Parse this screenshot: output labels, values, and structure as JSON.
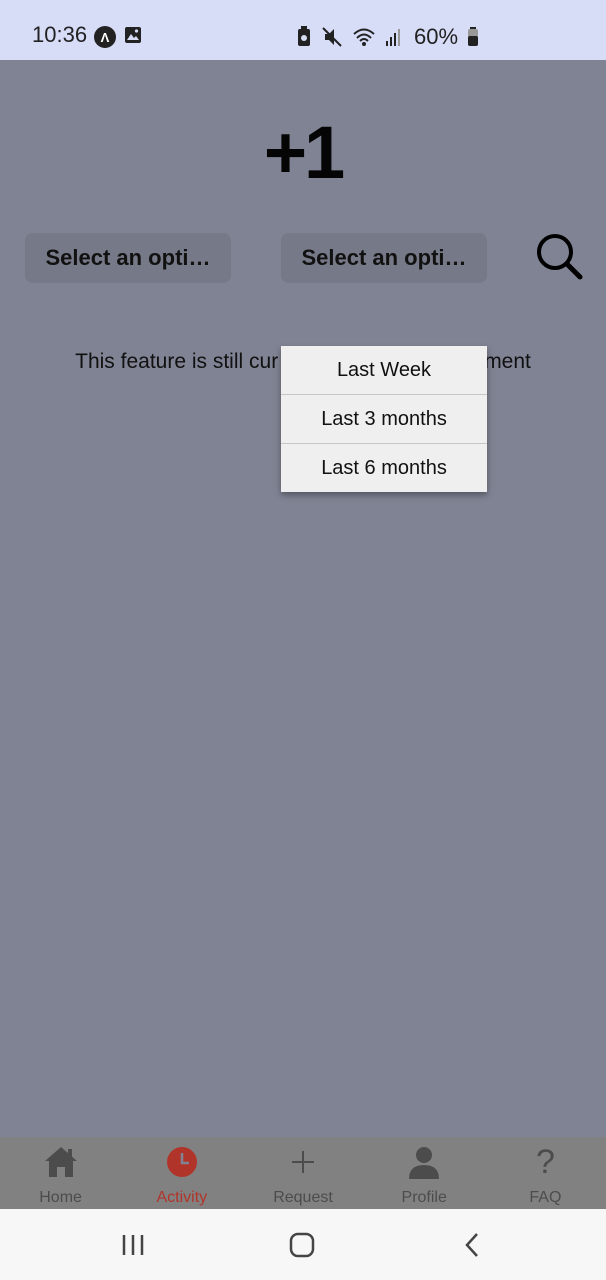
{
  "status_bar": {
    "time": "10:36",
    "battery": "60%"
  },
  "header": {
    "title": "+1"
  },
  "filters": {
    "select_1_label": "Select an opti…",
    "select_2_label": "Select an opti…"
  },
  "content": {
    "message_visible_left": "This feature is still cur",
    "message_visible_right": "ment"
  },
  "dropdown": {
    "options": [
      "Last Week",
      "Last 3 months",
      "Last 6 months"
    ]
  },
  "bottom_nav": {
    "items": [
      {
        "label": "Home",
        "icon": "home-icon"
      },
      {
        "label": "Activity",
        "icon": "clock-icon",
        "active": true
      },
      {
        "label": "Request",
        "icon": "plus-icon"
      },
      {
        "label": "Profile",
        "icon": "person-icon"
      },
      {
        "label": "FAQ",
        "icon": "question-icon"
      }
    ]
  },
  "colors": {
    "status_bar_bg": "#d7dcf7",
    "overlay_bg": "#7f8393",
    "active_tab": "#b0342a"
  }
}
